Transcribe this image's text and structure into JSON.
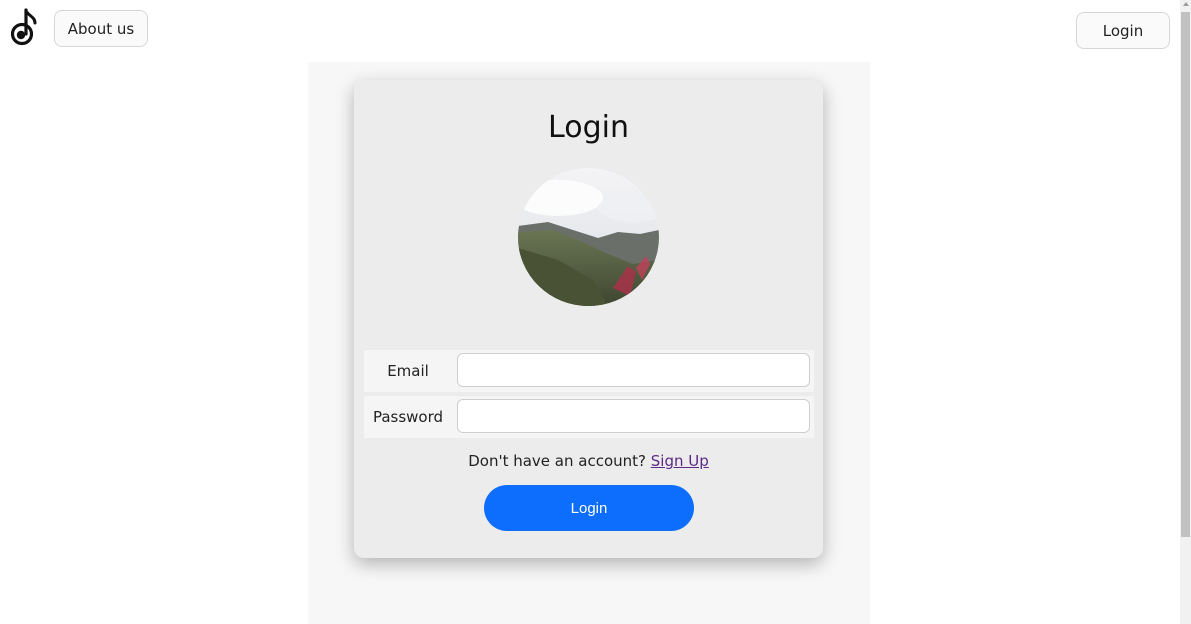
{
  "header": {
    "about_label": "About us",
    "login_label": "Login"
  },
  "login_card": {
    "title": "Login",
    "avatar_icon": "mountain-landscape-photo",
    "fields": [
      {
        "label": "Email",
        "value": "",
        "placeholder": ""
      },
      {
        "label": "Password",
        "value": "",
        "placeholder": ""
      }
    ],
    "signup_prompt": "Don't have an account?",
    "signup_link": "Sign Up",
    "submit_label": "Login"
  },
  "colors": {
    "accent": "#0d6efd",
    "card_bg": "#ececec",
    "link": "#5b2a86"
  },
  "icons": {
    "logo": "music-note-icon"
  }
}
